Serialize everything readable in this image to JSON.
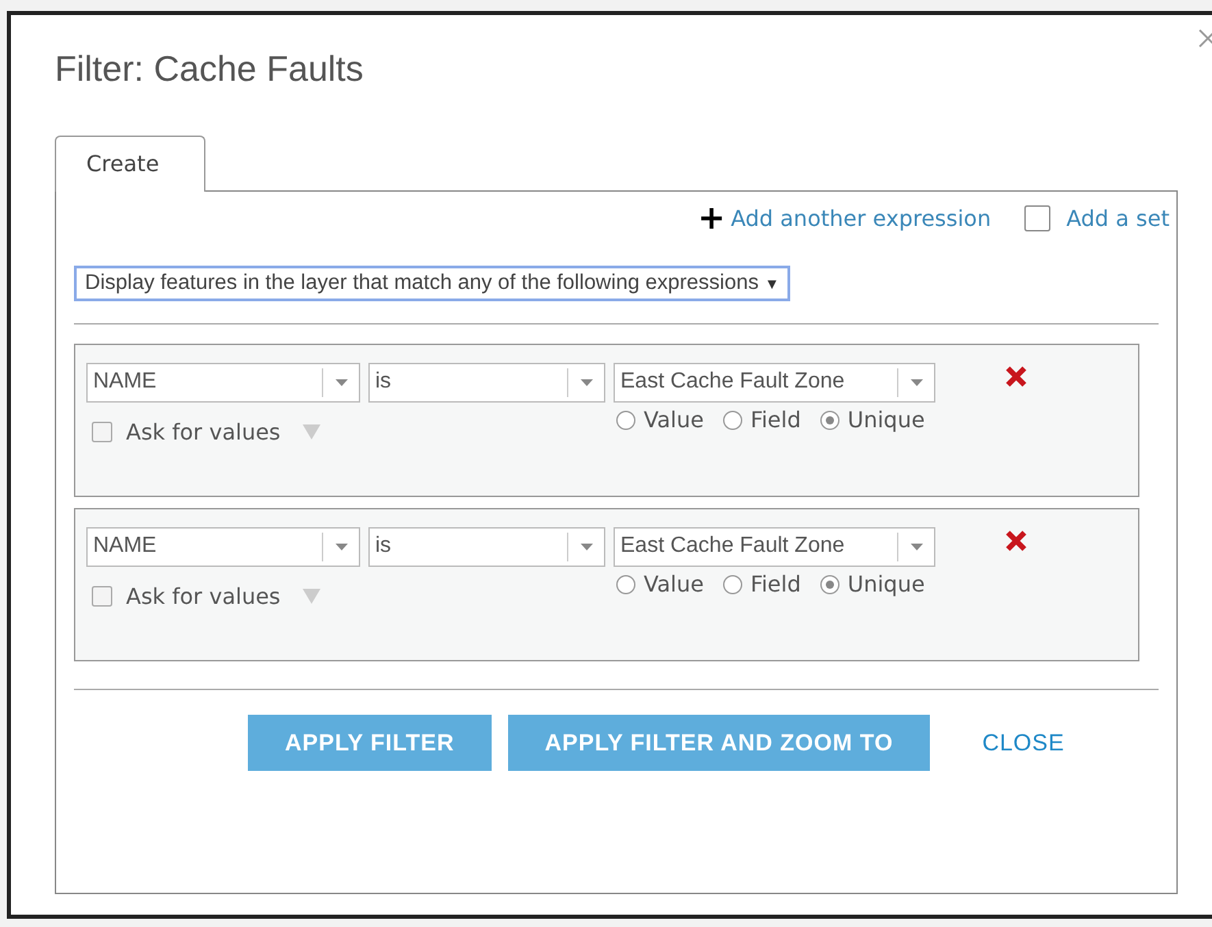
{
  "dialog": {
    "title": "Filter: Cache Faults"
  },
  "tabs": [
    {
      "label": "Create",
      "selected": true
    }
  ],
  "add_expression": {
    "icon": "+",
    "label": "Add another expression"
  },
  "add_set": {
    "label": "Add a set",
    "checked": false
  },
  "match_select": {
    "value": "Display features in the layer that match any of the following expressions",
    "arrow": "▼"
  },
  "expressions": [
    {
      "field": "NAME",
      "operator": "is",
      "value": "East Cache Fault Zone",
      "options": [
        {
          "label": "Value",
          "selected": false
        },
        {
          "label": "Field",
          "selected": false
        },
        {
          "label": "Unique",
          "selected": true
        }
      ],
      "ask_for_values": {
        "label": "Ask for values",
        "checked": false
      }
    },
    {
      "field": "NAME",
      "operator": "is",
      "value": "East Cache Fault Zone",
      "options": [
        {
          "label": "Value",
          "selected": false
        },
        {
          "label": "Field",
          "selected": false
        },
        {
          "label": "Unique",
          "selected": true
        }
      ],
      "ask_for_values": {
        "label": "Ask for values",
        "checked": false
      }
    }
  ],
  "buttons": [
    {
      "label": "APPLY FILTER",
      "kind": "primary"
    },
    {
      "label": "APPLY FILTER AND ZOOM TO",
      "kind": "primary"
    },
    {
      "label": "CLOSE",
      "kind": "link"
    }
  ]
}
